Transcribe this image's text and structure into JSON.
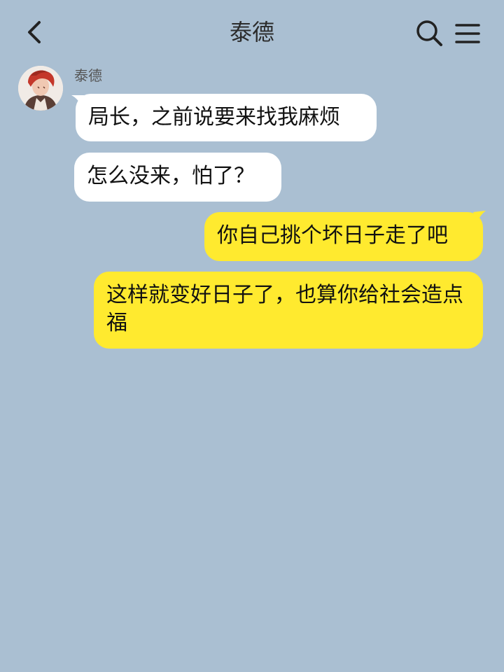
{
  "header": {
    "title": "泰德",
    "back_icon": "chevron-left-icon",
    "search_icon": "search-icon",
    "menu_icon": "hamburger-menu-icon"
  },
  "sender": {
    "name": "泰德"
  },
  "messages": [
    {
      "side": "left",
      "text": "局长，之前说要来找我麻烦"
    },
    {
      "side": "left",
      "text": "怎么没来，怕了？"
    },
    {
      "side": "right",
      "text": "你自己挑个坏日子走了吧"
    },
    {
      "side": "right",
      "text": "这样就变好日子了，也算你给社会造点福"
    }
  ],
  "colors": {
    "background": "#aabfd2",
    "incoming_bubble": "#ffffff",
    "outgoing_bubble": "#ffea2f"
  }
}
